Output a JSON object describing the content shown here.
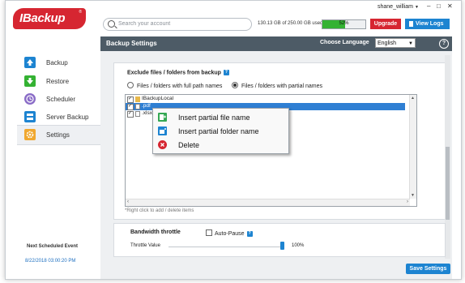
{
  "app": {
    "logo_text": "IBackup",
    "logo_mark": "®"
  },
  "header": {
    "user": "shane_william",
    "search_placeholder": "Search your account",
    "usage_text": "130.13 GB of 250.00 GB used",
    "quota_percent": 52,
    "quota_label": "52%",
    "upgrade_label": "Upgrade",
    "view_logs_label": "View Logs",
    "window_controls": [
      "–",
      "□",
      "✕"
    ]
  },
  "page_header": {
    "title": "Backup Settings",
    "language_label": "Choose Language",
    "language_value": "English",
    "help_label": "?"
  },
  "sidebar": {
    "items": [
      {
        "label": "Backup",
        "icon": "backup-icon",
        "color": "#1d84d1"
      },
      {
        "label": "Restore",
        "icon": "restore-icon",
        "color": "#34b233"
      },
      {
        "label": "Scheduler",
        "icon": "scheduler-icon",
        "color": "#8a6cc7"
      },
      {
        "label": "Server Backup",
        "icon": "server-icon",
        "color": "#1d84d1"
      },
      {
        "label": "Settings",
        "icon": "settings-icon",
        "color": "#f0a830"
      }
    ],
    "active_index": 4,
    "next_event_label": "Next Scheduled Event",
    "next_event_time": "8/22/2018 03:00:20 PM"
  },
  "exclude": {
    "title": "Exclude files / folders from backup",
    "option_full": "Files / folders with full path names",
    "option_partial": "Files / folders with partial names",
    "selected_option": "partial",
    "rows": [
      {
        "label": "IBackupLocal",
        "checked": true,
        "selected": false
      },
      {
        "label": ".pdf",
        "checked": true,
        "selected": true
      },
      {
        "label": ".xlsx",
        "checked": true,
        "selected": false
      }
    ],
    "hint": "*Right click to add / delete items"
  },
  "throttle": {
    "title": "Bandwidth throttle",
    "auto_pause_label": "Auto-Pause",
    "throttle_value_label": "Throttle Value",
    "value_percent": 100,
    "value_label": "100%"
  },
  "save_label": "Save Settings",
  "context_menu": {
    "items": [
      {
        "label": "Insert partial file name",
        "icon": "insert-file-icon",
        "color": "#34a853"
      },
      {
        "label": "Insert partial folder name",
        "icon": "insert-folder-icon",
        "color": "#1d84d1"
      },
      {
        "label": "Delete",
        "icon": "delete-icon",
        "color": "#d62631"
      }
    ]
  },
  "colors": {
    "accent": "#1d84d1",
    "brand": "#d62631",
    "header_bar": "#4d5b66",
    "progress": "#34b233"
  }
}
